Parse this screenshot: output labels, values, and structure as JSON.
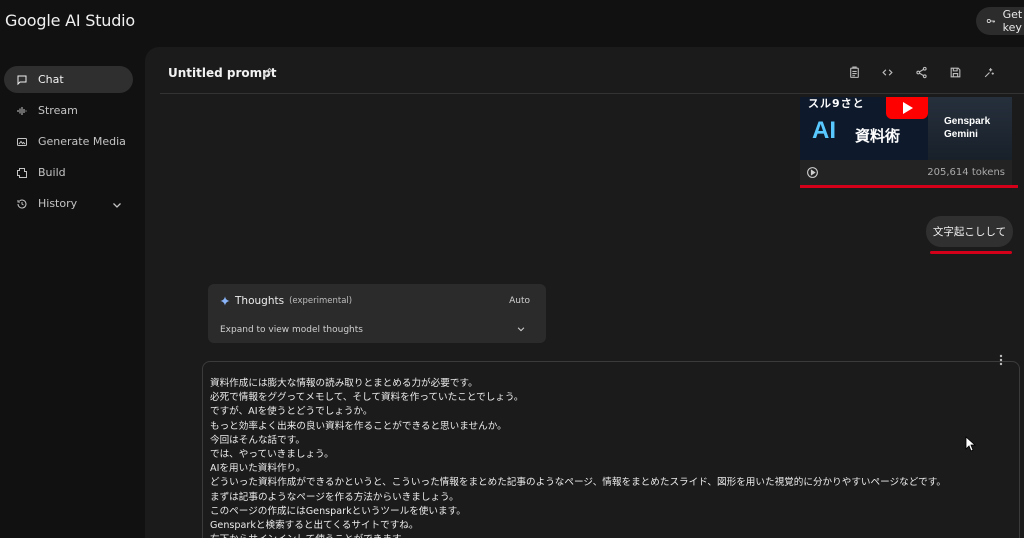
{
  "app": {
    "title": "Google AI Studio",
    "get_key_label": "Get API key"
  },
  "sidebar": {
    "items": [
      {
        "label": "Chat",
        "icon": "chat-icon",
        "active": true
      },
      {
        "label": "Stream",
        "icon": "stream-icon",
        "active": false
      },
      {
        "label": "Generate Media",
        "icon": "media-icon",
        "active": false
      },
      {
        "label": "Build",
        "icon": "build-icon",
        "active": false
      },
      {
        "label": "History",
        "icon": "history-icon",
        "active": false,
        "expandable": true
      }
    ]
  },
  "header": {
    "title": "Untitled prompt",
    "icons": [
      "clipboard-icon",
      "code-icon",
      "share-icon",
      "save-icon",
      "compare-icon"
    ]
  },
  "video": {
    "thumb_top": "スル9さと",
    "thumb_ai": "AI",
    "thumb_kanji": "資料術",
    "thumb_line1": "Genspark",
    "thumb_line2": "Gemini",
    "tokens": "205,614 tokens"
  },
  "user_message": "文字起こしして",
  "thoughts": {
    "title": "Thoughts",
    "badge": "(experimental)",
    "mode": "Auto",
    "expand_label": "Expand to view model thoughts"
  },
  "response": {
    "lines": [
      "資料作成には膨大な情報の読み取りとまとめる力が必要です。",
      "必死で情報をググってメモして、そして資料を作っていたことでしょう。",
      "ですが、AIを使うとどうでしょうか。",
      "もっと効率よく出来の良い資料を作ることができると思いませんか。",
      "今回はそんな話です。",
      "では、やっていきましょう。",
      "AIを用いた資料作り。",
      "どういった資料作成ができるかというと、こういった情報をまとめた記事のようなページ、情報をまとめたスライド、図形を用いた視覚的に分かりやすいページなどです。",
      "まずは記事のようなページを作る方法からいきましょう。",
      "このページの作成にはGensparkというツールを使います。",
      "Gensparkと検索すると出てくるサイトですね。",
      "右下からサインインして使うことができます。"
    ]
  },
  "colors": {
    "accent_red": "#d4001a",
    "background": "#1b1b1b",
    "sidebar": "#111111"
  }
}
